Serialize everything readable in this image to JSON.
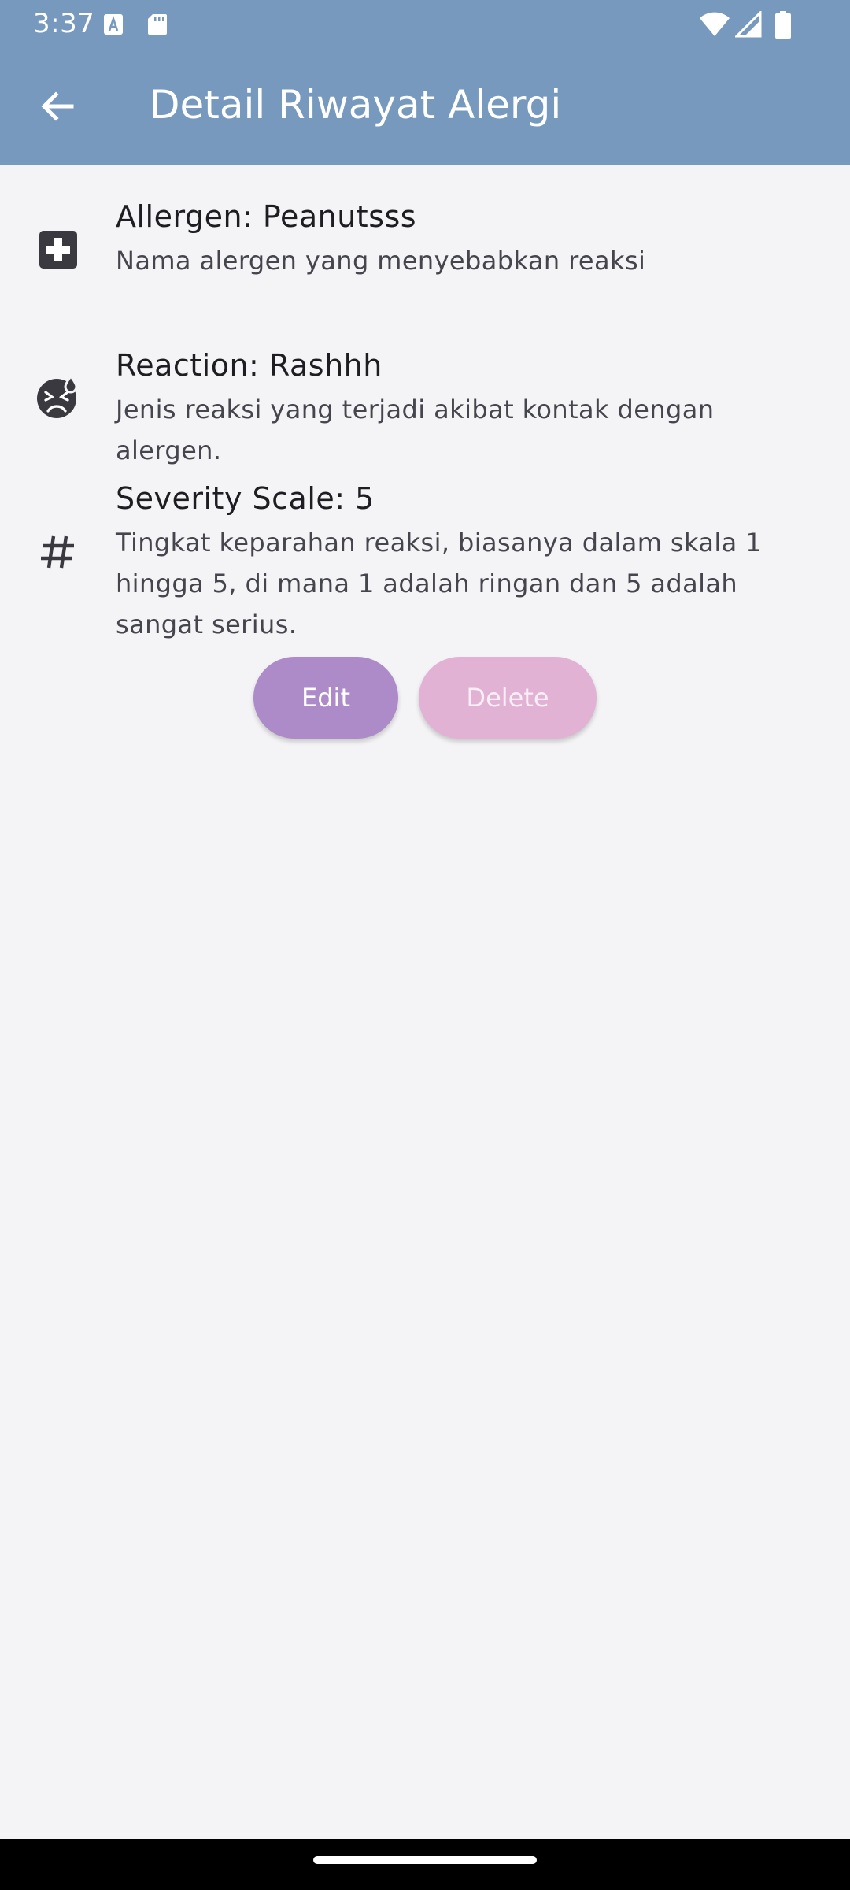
{
  "status_bar": {
    "time": "3:37",
    "left_icons": [
      "text-accessibility-icon",
      "sd-card-icon"
    ],
    "right_icons": [
      "wifi-icon",
      "signal-icon",
      "battery-icon"
    ]
  },
  "app_bar": {
    "title": "Detail Riwayat Alergi",
    "back_icon": "arrow-back-icon"
  },
  "details": [
    {
      "icon": "medical-cross-icon",
      "title": "Allergen: Peanutsss",
      "subtitle": "Nama alergen yang menyebabkan reaksi"
    },
    {
      "icon": "sick-face-icon",
      "title": "Reaction: Rashhh",
      "subtitle": "Jenis reaksi yang terjadi akibat kontak dengan alergen."
    },
    {
      "icon": "hash-icon",
      "title": "Severity Scale: 5",
      "subtitle": "Tingkat keparahan reaksi, biasanya dalam skala 1 hingga 5, di mana 1 adalah ringan dan 5 adalah sangat serius."
    }
  ],
  "actions": {
    "edit_label": "Edit",
    "delete_label": "Delete"
  },
  "colors": {
    "header": "#7699bd",
    "background": "#f4f4f6",
    "edit_button": "#ad8bc9",
    "delete_button": "#e1b2d3",
    "icon": "#3a3940"
  }
}
